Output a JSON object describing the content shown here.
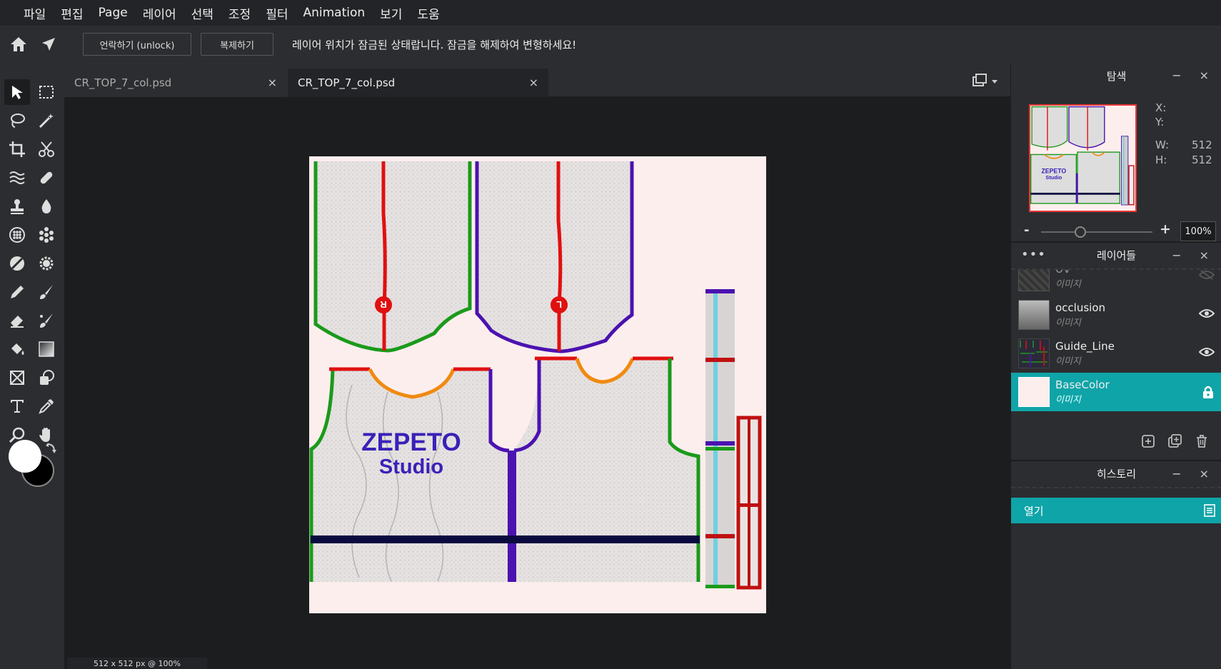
{
  "menu": [
    "파일",
    "편집",
    "Page",
    "레이어",
    "선택",
    "조정",
    "필터",
    "Animation",
    "보기",
    "도움"
  ],
  "options": {
    "unlock_label": "언락하기 (unlock)",
    "duplicate_label": "복제하기",
    "message": "레이어 위치가 잠금된 상태랍니다. 잠금을 해제하여 변형하세요!"
  },
  "tabs": [
    {
      "label": "CR_TOP_7_col.psd",
      "active": false
    },
    {
      "label": "CR_TOP_7_col.psd",
      "active": true
    }
  ],
  "tab_close": "×",
  "canvas": {
    "logo_line1": "ZEPETO",
    "logo_line2": "Studio",
    "left_mark": "R",
    "right_mark": "L"
  },
  "status": "512 x 512 px @ 100%",
  "navigator": {
    "title": "탐색",
    "x_label": "X:",
    "y_label": "Y:",
    "w_label": "W:",
    "h_label": "H:",
    "w_value": "512",
    "h_value": "512",
    "zoom_minus": "-",
    "zoom_plus": "+",
    "zoom_value": "100%",
    "zoom_level": 0.35
  },
  "layers": {
    "title": "레이어들",
    "items": [
      {
        "name": "UV",
        "type": "이미지",
        "visible": false,
        "selected": false
      },
      {
        "name": "occlusion",
        "type": "이미지",
        "visible": true,
        "selected": false
      },
      {
        "name": "Guide_Line",
        "type": "이미지",
        "visible": true,
        "selected": false
      },
      {
        "name": "BaseColor",
        "type": "이미지",
        "visible": true,
        "selected": true,
        "locked": true
      }
    ]
  },
  "history": {
    "title": "히스토리",
    "items": [
      "열기"
    ]
  },
  "panel_controls": "− ×",
  "colors": {
    "accent": "#0fa4a8",
    "foreground": "#ffffff",
    "background": "#000000",
    "doc_bg": "#fdeeee",
    "guide_red": "#e01010",
    "guide_green": "#1a9a1a",
    "guide_purple": "#4b12b0",
    "guide_orange": "#f08a10",
    "guide_navy": "#0a0a40"
  }
}
